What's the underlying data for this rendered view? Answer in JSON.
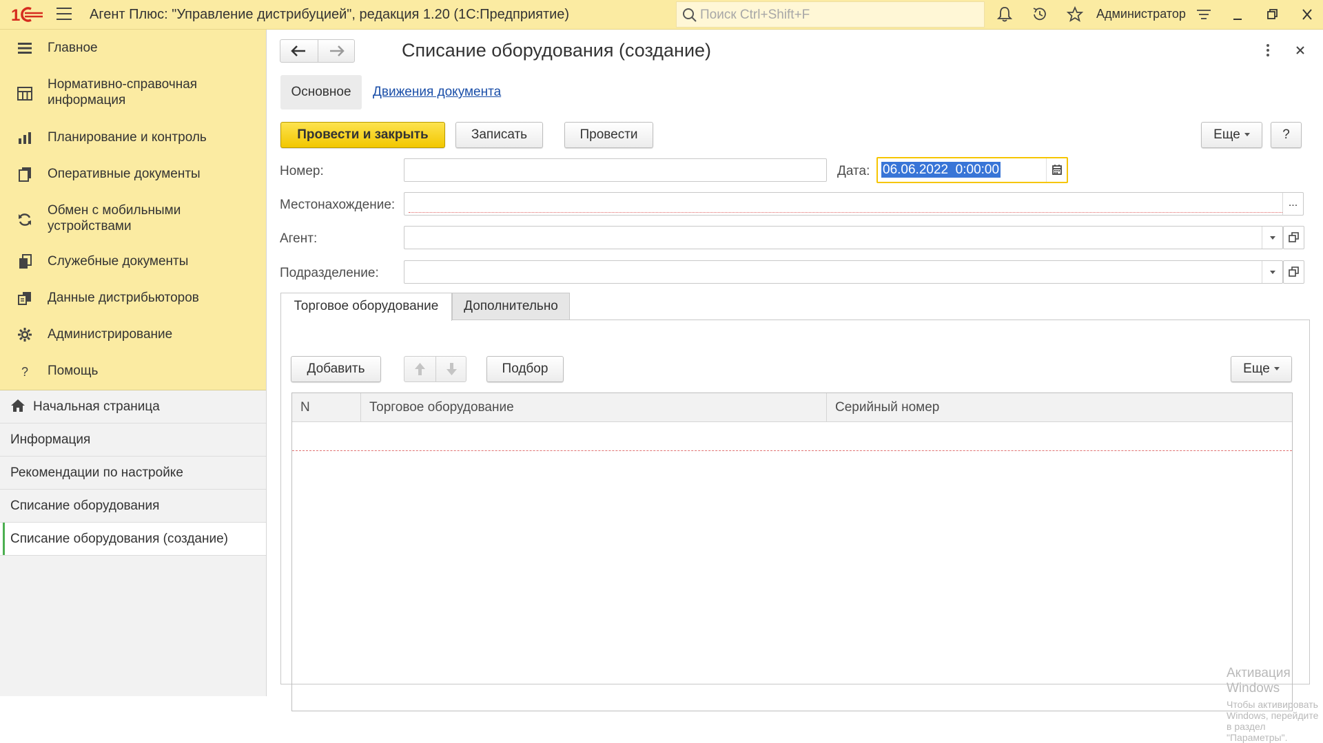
{
  "topbar": {
    "logo_text": "1С",
    "title": "Агент Плюс: \"Управление дистрибуцией\", редакция 1.20  (1С:Предприятие)",
    "search_placeholder": "Поиск Ctrl+Shift+F",
    "user": "Администратор",
    "icons": [
      "bell-icon",
      "history-icon",
      "star-icon",
      "settings-lines-icon",
      "minimize-icon",
      "restore-icon",
      "close-icon"
    ]
  },
  "sidebar": {
    "sections": [
      {
        "label": "Главное",
        "icon": "menu-lines-icon"
      },
      {
        "label": "Нормативно-справочная информация",
        "icon": "catalog-icon"
      },
      {
        "label": "Планирование и контроль",
        "icon": "bar-chart-icon"
      },
      {
        "label": "Оперативные документы",
        "icon": "documents-icon"
      },
      {
        "label": "Обмен с мобильными устройствами",
        "icon": "sync-icon"
      },
      {
        "label": "Служебные документы",
        "icon": "service-docs-icon"
      },
      {
        "label": "Данные дистрибьюторов",
        "icon": "distributor-data-icon"
      },
      {
        "label": "Администрирование",
        "icon": "gear-icon"
      },
      {
        "label": "Помощь",
        "icon": "question-icon"
      }
    ],
    "open_windows": [
      {
        "label": "Начальная страница"
      },
      {
        "label": "Информация"
      },
      {
        "label": "Рекомендации по настройке"
      },
      {
        "label": "Списание оборудования"
      },
      {
        "label": "Списание оборудования (создание)"
      }
    ]
  },
  "form": {
    "title": "Списание оборудования (создание)",
    "tabs": {
      "main": "Основное",
      "link": "Движения документа"
    },
    "toolbar": {
      "post_close": "Провести и закрыть",
      "save": "Записать",
      "post": "Провести",
      "more": "Еще",
      "help": "?"
    },
    "fields": {
      "number_label": "Номер:",
      "number_value": "",
      "date_label": "Дата:",
      "date_value": "06.06.2022  0:00:00",
      "location_label": "Местонахождение:",
      "location_value": "",
      "location_btn": "...",
      "agent_label": "Агент:",
      "agent_value": "",
      "division_label": "Подразделение:",
      "division_value": ""
    },
    "panel_tabs": [
      "Торговое оборудование",
      "Дополнительно"
    ],
    "table_toolbar": {
      "add": "Добавить",
      "select": "Подбор",
      "more": "Еще"
    },
    "table": {
      "columns": [
        "N",
        "Торговое оборудование",
        "Серийный номер"
      ],
      "rows": []
    }
  },
  "watermark": {
    "line1": "Активация Windows",
    "line2": "Чтобы активировать Windows, перейдите в раздел \"Параметры\"."
  },
  "colors": {
    "accent_yellow": "#fbeba2",
    "primary_button": "#f5d20c",
    "link": "#1a4ea8",
    "active_marker": "#4caf50"
  }
}
